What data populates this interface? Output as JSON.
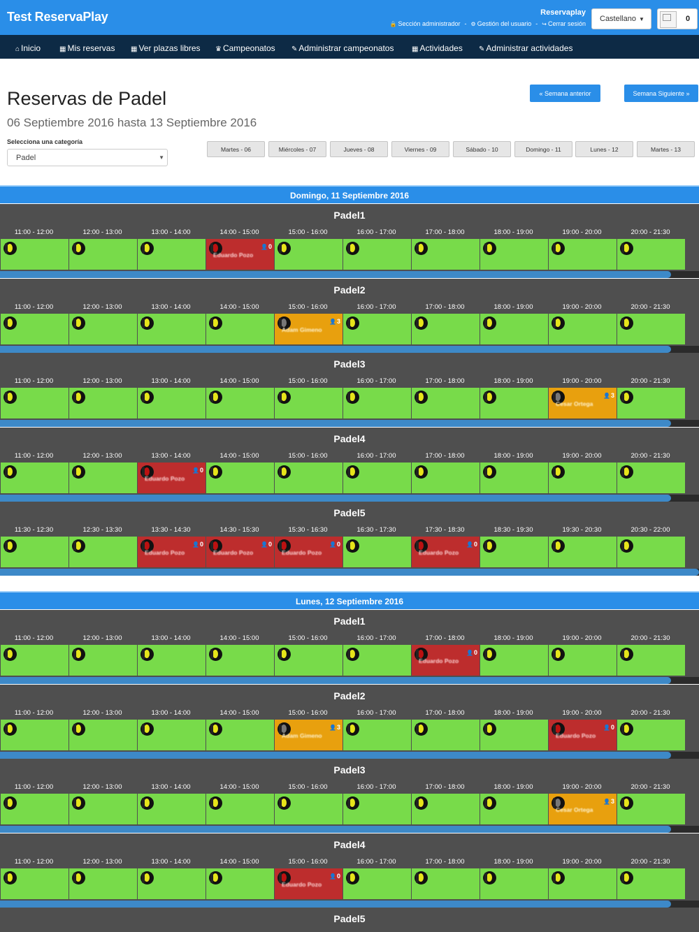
{
  "app": {
    "brand": "Test ReservaPlay",
    "username": "Reservaplay",
    "links": [
      {
        "icon": "lock-icon",
        "glyph": "🔒",
        "label": "Sección administrador"
      },
      {
        "icon": "gear-icon",
        "glyph": "⚙",
        "label": "Gestión del usuario"
      },
      {
        "icon": "signout-icon",
        "glyph": "↪",
        "label": "Cerrar sesión"
      }
    ],
    "language": "Castellano",
    "cart_count": "0"
  },
  "nav": [
    {
      "icon": "home-icon",
      "glyph": "⌂",
      "label": "Inicio"
    },
    {
      "icon": "calendar-icon",
      "glyph": "▦",
      "label": "Mis reservas"
    },
    {
      "icon": "calendar-icon",
      "glyph": "▦",
      "label": "Ver plazas libres"
    },
    {
      "icon": "trophy-icon",
      "glyph": "♛",
      "label": "Campeonatos"
    },
    {
      "icon": "wrench-icon",
      "glyph": "✎",
      "label": "Administrar campeonatos"
    },
    {
      "icon": "calendar-icon",
      "glyph": "▦",
      "label": "Actividades"
    },
    {
      "icon": "wrench-icon",
      "glyph": "✎",
      "label": "Administrar actividades"
    }
  ],
  "header": {
    "title": "Reservas de Padel",
    "date_range": "06 Septiembre 2016 hasta 13 Septiembre 2016",
    "prev_week": "« Semana anterior",
    "next_week": "Semana Siguiente »",
    "category_label": "Selecciona una categoría",
    "category_value": "Padel"
  },
  "day_buttons": [
    "Martes - 06",
    "Miércoles - 07",
    "Jueves - 08",
    "Viernes - 09",
    "Sábado - 10",
    "Domingo - 11",
    "Lunes - 12",
    "Martes - 13"
  ],
  "colors": {
    "free": "#78db4a",
    "booked": "#bd2d2d",
    "pending": "#e8a00e",
    "accent": "#2a8ee8"
  },
  "days": [
    {
      "title": "Domingo, 11 Septiembre 2016",
      "courts": [
        {
          "name": "Padel1",
          "times": [
            "11:00 - 12:00",
            "12:00 - 13:00",
            "13:00 - 14:00",
            "14:00 - 15:00",
            "15:00 - 16:00",
            "16:00 - 17:00",
            "17:00 - 18:00",
            "18:00 - 19:00",
            "19:00 - 20:00",
            "20:00 - 21:30"
          ],
          "slots": [
            {
              "state": "free"
            },
            {
              "state": "free"
            },
            {
              "state": "free"
            },
            {
              "state": "booked",
              "user": "Eduardo Pozo",
              "count": "0"
            },
            {
              "state": "free"
            },
            {
              "state": "free"
            },
            {
              "state": "free"
            },
            {
              "state": "free"
            },
            {
              "state": "free"
            },
            {
              "state": "free"
            }
          ],
          "progress": 0.96
        },
        {
          "name": "Padel2",
          "times": [
            "11:00 - 12:00",
            "12:00 - 13:00",
            "13:00 - 14:00",
            "14:00 - 15:00",
            "15:00 - 16:00",
            "16:00 - 17:00",
            "17:00 - 18:00",
            "18:00 - 19:00",
            "19:00 - 20:00",
            "20:00 - 21:30"
          ],
          "slots": [
            {
              "state": "free"
            },
            {
              "state": "free"
            },
            {
              "state": "free"
            },
            {
              "state": "free"
            },
            {
              "state": "pending",
              "user": "Adam Gimeno",
              "count": "3"
            },
            {
              "state": "free"
            },
            {
              "state": "free"
            },
            {
              "state": "free"
            },
            {
              "state": "free"
            },
            {
              "state": "free"
            }
          ],
          "progress": 0.96
        },
        {
          "name": "Padel3",
          "times": [
            "11:00 - 12:00",
            "12:00 - 13:00",
            "13:00 - 14:00",
            "14:00 - 15:00",
            "15:00 - 16:00",
            "16:00 - 17:00",
            "17:00 - 18:00",
            "18:00 - 19:00",
            "19:00 - 20:00",
            "20:00 - 21:30"
          ],
          "slots": [
            {
              "state": "free"
            },
            {
              "state": "free"
            },
            {
              "state": "free"
            },
            {
              "state": "free"
            },
            {
              "state": "free"
            },
            {
              "state": "free"
            },
            {
              "state": "free"
            },
            {
              "state": "free"
            },
            {
              "state": "pending",
              "user": "Cesar Ortega",
              "count": "3"
            },
            {
              "state": "free"
            }
          ],
          "progress": 0.96
        },
        {
          "name": "Padel4",
          "times": [
            "11:00 - 12:00",
            "12:00 - 13:00",
            "13:00 - 14:00",
            "14:00 - 15:00",
            "15:00 - 16:00",
            "16:00 - 17:00",
            "17:00 - 18:00",
            "18:00 - 19:00",
            "19:00 - 20:00",
            "20:00 - 21:30"
          ],
          "slots": [
            {
              "state": "free"
            },
            {
              "state": "free"
            },
            {
              "state": "booked",
              "user": "Eduardo Pozo",
              "count": "0"
            },
            {
              "state": "free"
            },
            {
              "state": "free"
            },
            {
              "state": "free"
            },
            {
              "state": "free"
            },
            {
              "state": "free"
            },
            {
              "state": "free"
            },
            {
              "state": "free"
            }
          ],
          "progress": 0.96
        },
        {
          "name": "Padel5",
          "times": [
            "11:30 - 12:30",
            "12:30 - 13:30",
            "13:30 - 14:30",
            "14:30 - 15:30",
            "15:30 - 16:30",
            "16:30 - 17:30",
            "17:30 - 18:30",
            "18:30 - 19:30",
            "19:30 - 20:30",
            "20:30 - 22:00"
          ],
          "slots": [
            {
              "state": "free"
            },
            {
              "state": "free"
            },
            {
              "state": "booked",
              "user": "Eduardo Pozo",
              "count": "0"
            },
            {
              "state": "booked",
              "user": "Eduardo Pozo",
              "count": "0"
            },
            {
              "state": "booked",
              "user": "Eduardo Pozo",
              "count": "0"
            },
            {
              "state": "free"
            },
            {
              "state": "booked",
              "user": "Eduardo Pozo",
              "count": "0"
            },
            {
              "state": "free"
            },
            {
              "state": "free"
            },
            {
              "state": "free"
            }
          ],
          "progress": 1.0
        }
      ]
    },
    {
      "title": "Lunes, 12 Septiembre 2016",
      "courts": [
        {
          "name": "Padel1",
          "times": [
            "11:00 - 12:00",
            "12:00 - 13:00",
            "13:00 - 14:00",
            "14:00 - 15:00",
            "15:00 - 16:00",
            "16:00 - 17:00",
            "17:00 - 18:00",
            "18:00 - 19:00",
            "19:00 - 20:00",
            "20:00 - 21:30"
          ],
          "slots": [
            {
              "state": "free"
            },
            {
              "state": "free"
            },
            {
              "state": "free"
            },
            {
              "state": "free"
            },
            {
              "state": "free"
            },
            {
              "state": "free"
            },
            {
              "state": "booked",
              "user": "Eduardo Pozo",
              "count": "0"
            },
            {
              "state": "free"
            },
            {
              "state": "free"
            },
            {
              "state": "free"
            }
          ],
          "progress": 0.96
        },
        {
          "name": "Padel2",
          "times": [
            "11:00 - 12:00",
            "12:00 - 13:00",
            "13:00 - 14:00",
            "14:00 - 15:00",
            "15:00 - 16:00",
            "16:00 - 17:00",
            "17:00 - 18:00",
            "18:00 - 19:00",
            "19:00 - 20:00",
            "20:00 - 21:30"
          ],
          "slots": [
            {
              "state": "free"
            },
            {
              "state": "free"
            },
            {
              "state": "free"
            },
            {
              "state": "free"
            },
            {
              "state": "pending",
              "user": "Adam Gimeno",
              "count": "3"
            },
            {
              "state": "free"
            },
            {
              "state": "free"
            },
            {
              "state": "free"
            },
            {
              "state": "booked",
              "user": "Eduardo Pozo",
              "count": "0"
            },
            {
              "state": "free"
            }
          ],
          "progress": 0.96
        },
        {
          "name": "Padel3",
          "times": [
            "11:00 - 12:00",
            "12:00 - 13:00",
            "13:00 - 14:00",
            "14:00 - 15:00",
            "15:00 - 16:00",
            "16:00 - 17:00",
            "17:00 - 18:00",
            "18:00 - 19:00",
            "19:00 - 20:00",
            "20:00 - 21:30"
          ],
          "slots": [
            {
              "state": "free"
            },
            {
              "state": "free"
            },
            {
              "state": "free"
            },
            {
              "state": "free"
            },
            {
              "state": "free"
            },
            {
              "state": "free"
            },
            {
              "state": "free"
            },
            {
              "state": "free"
            },
            {
              "state": "pending",
              "user": "Cesar Ortega",
              "count": "3"
            },
            {
              "state": "free"
            }
          ],
          "progress": 0.96
        },
        {
          "name": "Padel4",
          "times": [
            "11:00 - 12:00",
            "12:00 - 13:00",
            "13:00 - 14:00",
            "14:00 - 15:00",
            "15:00 - 16:00",
            "16:00 - 17:00",
            "17:00 - 18:00",
            "18:00 - 19:00",
            "19:00 - 20:00",
            "20:00 - 21:30"
          ],
          "slots": [
            {
              "state": "free"
            },
            {
              "state": "free"
            },
            {
              "state": "free"
            },
            {
              "state": "free"
            },
            {
              "state": "booked",
              "user": "Eduardo Pozo",
              "count": "0"
            },
            {
              "state": "free"
            },
            {
              "state": "free"
            },
            {
              "state": "free"
            },
            {
              "state": "free"
            },
            {
              "state": "free"
            }
          ],
          "progress": 0.96
        },
        {
          "name": "Padel5",
          "times": [],
          "slots": []
        }
      ]
    }
  ]
}
